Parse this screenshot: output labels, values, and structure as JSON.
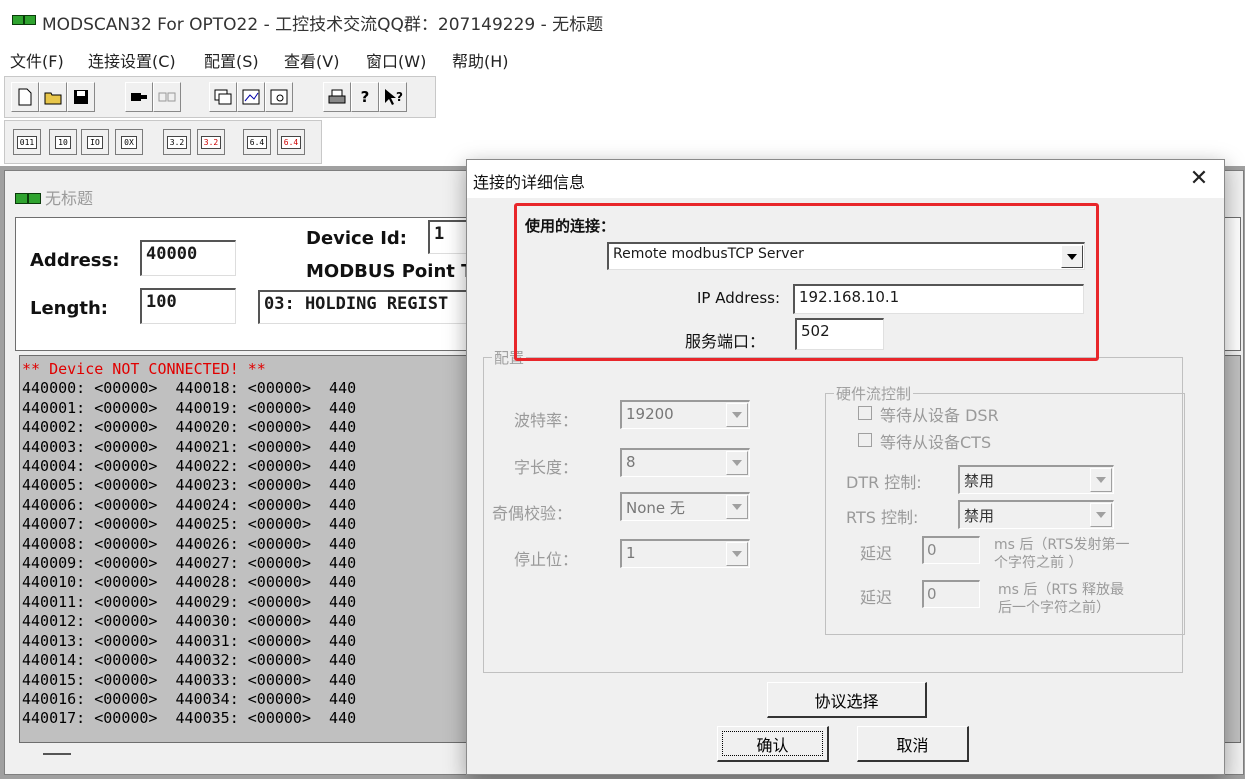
{
  "app": {
    "title": "MODSCAN32 For OPTO22 - 工控技术交流QQ群：207149229 - 无标题"
  },
  "menu": [
    "文件(F)",
    "连接设置(C)",
    "配置(S)",
    "查看(V)",
    "窗口(W)",
    "帮助(H)"
  ],
  "toolbar1": [
    "new",
    "open",
    "save",
    "connect",
    "disconnect",
    "view-1",
    "view-2",
    "view-3",
    "print",
    "help",
    "context-help"
  ],
  "toolbar2": [
    "011",
    "10",
    "IO",
    "0X",
    "3.2",
    "3.2",
    "6.4",
    "6.4"
  ],
  "child": {
    "title": "无标题",
    "address_label": "Address:",
    "address_value": "40000",
    "length_label": "Length:",
    "length_value": "100",
    "device_id_label": "Device Id:",
    "device_id_value": "1",
    "point_type_label": "MODBUS Point T",
    "point_type_value": "03: HOLDING REGIST",
    "status_line": "** Device NOT CONNECTED! **",
    "col1": [
      "440000: <00000>",
      "440001: <00000>",
      "440002: <00000>",
      "440003: <00000>",
      "440004: <00000>",
      "440005: <00000>",
      "440006: <00000>",
      "440007: <00000>",
      "440008: <00000>",
      "440009: <00000>",
      "440010: <00000>",
      "440011: <00000>",
      "440012: <00000>",
      "440013: <00000>",
      "440014: <00000>",
      "440015: <00000>",
      "440016: <00000>",
      "440017: <00000>"
    ],
    "col2": [
      "440018: <00000>",
      "440019: <00000>",
      "440020: <00000>",
      "440021: <00000>",
      "440022: <00000>",
      "440023: <00000>",
      "440024: <00000>",
      "440025: <00000>",
      "440026: <00000>",
      "440027: <00000>",
      "440028: <00000>",
      "440029: <00000>",
      "440030: <00000>",
      "440031: <00000>",
      "440032: <00000>",
      "440033: <00000>",
      "440034: <00000>",
      "440035: <00000>"
    ],
    "col3_prefix": "440"
  },
  "dialog": {
    "title": "连接的详细信息",
    "close_glyph": "✕",
    "connection_label": "使用的连接：",
    "connection_value": "Remote modbusTCP Server",
    "ip_label": "IP Address:",
    "ip_value": "192.168.10.1",
    "port_label": "服务端口：",
    "port_value": "502",
    "config_group": "配置",
    "baud_label": "波特率：",
    "baud_value": "19200",
    "wordlen_label": "字长度：",
    "wordlen_value": "8",
    "parity_label": "奇偶校验：",
    "parity_value": "None 无",
    "stopbits_label": "停止位：",
    "stopbits_value": "1",
    "flow_group": "硬件流控制",
    "dsr_label": "等待从设备 DSR",
    "cts_label": "等待从设备CTS",
    "dtr_label": "DTR 控制:",
    "dtr_value": "禁用",
    "rts_label": "RTS 控制:",
    "rts_value": "禁用",
    "delay_label": "延迟",
    "delay1_value": "0",
    "delay1_note_a": "ms 后（RTS发射第一",
    "delay1_note_b": "个字符之前 ）",
    "delay2_value": "0",
    "delay2_note_a": "ms 后（RTS 释放最",
    "delay2_note_b": "后一个字符之前）",
    "protocol_button": "协议选择",
    "ok_button": "确认",
    "cancel_button": "取消"
  },
  "colors": {
    "highlight": "#e8262a",
    "status_red": "#e00000",
    "register_bg": "#c0c0c0"
  }
}
